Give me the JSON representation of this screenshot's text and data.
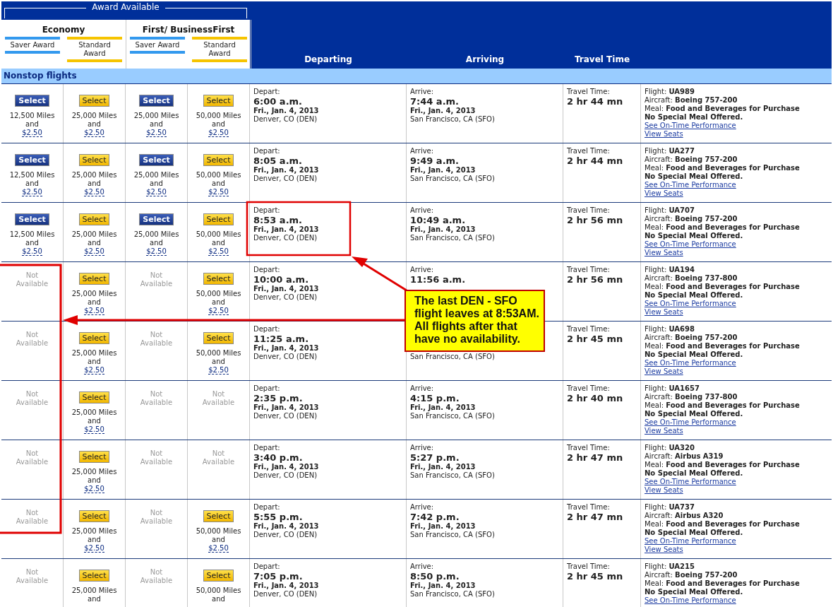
{
  "award_header": {
    "title": "Award Available",
    "groups": [
      {
        "name": "Economy",
        "awards": [
          {
            "label": "Saver Award",
            "kind": "saver"
          },
          {
            "label": "Standard Award",
            "kind": "standard"
          }
        ]
      },
      {
        "name": "First/ BusinessFirst",
        "awards": [
          {
            "label": "Saver Award",
            "kind": "saver"
          },
          {
            "label": "Standard Award",
            "kind": "standard"
          }
        ]
      }
    ]
  },
  "columns": [
    "Departing",
    "Arriving",
    "Travel Time"
  ],
  "section": "Nonstop flights",
  "flights": [
    {
      "options": [
        {
          "kind": "saver",
          "available": true,
          "button": "Select",
          "miles": "12,500 Miles",
          "and": "and",
          "fee": "$2.50"
        },
        {
          "kind": "standard",
          "available": true,
          "button": "Select",
          "miles": "25,000 Miles",
          "and": "and",
          "fee": "$2.50"
        },
        {
          "kind": "saver",
          "available": true,
          "button": "Select",
          "miles": "25,000 Miles",
          "and": "and",
          "fee": "$2.50"
        },
        {
          "kind": "standard",
          "available": true,
          "button": "Select",
          "miles": "50,000 Miles",
          "and": "and",
          "fee": "$2.50"
        }
      ],
      "depart": {
        "label": "Depart:",
        "time": "6:00 a.m.",
        "date": "Fri., Jan. 4, 2013",
        "city": "Denver, CO (DEN)"
      },
      "arrive": {
        "label": "Arrive:",
        "time": "7:44 a.m.",
        "date": "Fri., Jan. 4, 2013",
        "city": "San Francisco, CA (SFO)"
      },
      "travel": {
        "label": "Travel Time:",
        "value": "2 hr 44 mn"
      },
      "info": {
        "flight": "Flight: **UA989**",
        "aircraft": "Aircraft: **Boeing 757-200**",
        "meal": "Meal: **Food and Beverages for Purchase**",
        "note": "No Special Meal Offered.",
        "links": [
          "See On-Time Performance",
          "View Seats"
        ]
      }
    },
    {
      "options": [
        {
          "kind": "saver",
          "available": true,
          "button": "Select",
          "miles": "12,500 Miles",
          "and": "and",
          "fee": "$2.50"
        },
        {
          "kind": "standard",
          "available": true,
          "button": "Select",
          "miles": "25,000 Miles",
          "and": "and",
          "fee": "$2.50"
        },
        {
          "kind": "saver",
          "available": true,
          "button": "Select",
          "miles": "25,000 Miles",
          "and": "and",
          "fee": "$2.50"
        },
        {
          "kind": "standard",
          "available": true,
          "button": "Select",
          "miles": "50,000 Miles",
          "and": "and",
          "fee": "$2.50"
        }
      ],
      "depart": {
        "label": "Depart:",
        "time": "8:05 a.m.",
        "date": "Fri., Jan. 4, 2013",
        "city": "Denver, CO (DEN)"
      },
      "arrive": {
        "label": "Arrive:",
        "time": "9:49 a.m.",
        "date": "Fri., Jan. 4, 2013",
        "city": "San Francisco, CA (SFO)"
      },
      "travel": {
        "label": "Travel Time:",
        "value": "2 hr 44 mn"
      },
      "info": {
        "flight": "Flight: **UA277**",
        "aircraft": "Aircraft: **Boeing 757-200**",
        "meal": "Meal: **Food and Beverages for Purchase**",
        "note": "No Special Meal Offered.",
        "links": [
          "See On-Time Performance",
          "View Seats"
        ]
      }
    },
    {
      "options": [
        {
          "kind": "saver",
          "available": true,
          "button": "Select",
          "miles": "12,500 Miles",
          "and": "and",
          "fee": "$2.50"
        },
        {
          "kind": "standard",
          "available": true,
          "button": "Select",
          "miles": "25,000 Miles",
          "and": "and",
          "fee": "$2.50"
        },
        {
          "kind": "saver",
          "available": true,
          "button": "Select",
          "miles": "25,000 Miles",
          "and": "and",
          "fee": "$2.50"
        },
        {
          "kind": "standard",
          "available": true,
          "button": "Select",
          "miles": "50,000 Miles",
          "and": "and",
          "fee": "$2.50"
        }
      ],
      "depart": {
        "label": "Depart:",
        "time": "8:53 a.m.",
        "date": "Fri., Jan. 4, 2013",
        "city": "Denver, CO (DEN)"
      },
      "arrive": {
        "label": "Arrive:",
        "time": "10:49 a.m.",
        "date": "Fri., Jan. 4, 2013",
        "city": "San Francisco, CA (SFO)"
      },
      "travel": {
        "label": "Travel Time:",
        "value": "2 hr 56 mn"
      },
      "info": {
        "flight": "Flight: **UA707**",
        "aircraft": "Aircraft: **Boeing 757-200**",
        "meal": "Meal: **Food and Beverages for Purchase**",
        "note": "No Special Meal Offered.",
        "links": [
          "See On-Time Performance",
          "View Seats"
        ]
      }
    },
    {
      "options": [
        {
          "kind": "saver",
          "available": false,
          "text": "Not Available"
        },
        {
          "kind": "standard",
          "available": true,
          "button": "Select",
          "miles": "25,000 Miles",
          "and": "and",
          "fee": "$2.50"
        },
        {
          "kind": "saver",
          "available": false,
          "text": "Not Available"
        },
        {
          "kind": "standard",
          "available": true,
          "button": "Select",
          "miles": "50,000 Miles",
          "and": "and",
          "fee": "$2.50"
        }
      ],
      "depart": {
        "label": "Depart:",
        "time": "10:00 a.m.",
        "date": "Fri., Jan. 4, 2013",
        "city": "Denver, CO (DEN)"
      },
      "arrive": {
        "label": "Arrive:",
        "time": "11:56 a.m."
      },
      "travel": {
        "label": "Travel Time:",
        "value": "2 hr 56 mn"
      },
      "info": {
        "flight": "Flight: **UA194**",
        "aircraft": "Aircraft: **Boeing 737-800**",
        "meal": "Meal: **Food and Beverages for Purchase**",
        "note": "No Special Meal Offered.",
        "links": [
          "See On-Time Performance",
          "View Seats"
        ]
      }
    },
    {
      "options": [
        {
          "kind": "saver",
          "available": false,
          "text": "Not Available"
        },
        {
          "kind": "standard",
          "available": true,
          "button": "Select",
          "miles": "25,000 Miles",
          "and": "and",
          "fee": "$2.50"
        },
        {
          "kind": "saver",
          "available": false,
          "text": "Not Available"
        },
        {
          "kind": "standard",
          "available": true,
          "button": "Select",
          "miles": "50,000 Miles",
          "and": "and",
          "fee": "$2.50"
        }
      ],
      "depart": {
        "label": "Depart:",
        "time": "11:25 a.m.",
        "date": "Fri., Jan. 4, 2013",
        "city": "Denver, CO (DEN)"
      },
      "arrive": {
        "city": "San Francisco, CA (SFO)"
      },
      "travel": {
        "label": "Travel Time:",
        "value": "2 hr 45 mn"
      },
      "info": {
        "flight": "Flight: **UA698**",
        "aircraft": "Aircraft: **Boeing 757-200**",
        "meal": "Meal: **Food and Beverages for Purchase**",
        "note": "No Special Meal Offered.",
        "links": [
          "See On-Time Performance",
          "View Seats"
        ]
      }
    },
    {
      "options": [
        {
          "kind": "saver",
          "available": false,
          "text": "Not Available"
        },
        {
          "kind": "standard",
          "available": true,
          "button": "Select",
          "miles": "25,000 Miles",
          "and": "and",
          "fee": "$2.50"
        },
        {
          "kind": "saver",
          "available": false,
          "text": "Not Available"
        },
        {
          "kind": "standard",
          "available": false,
          "text": "Not Available"
        }
      ],
      "depart": {
        "label": "Depart:",
        "time": "2:35 p.m.",
        "date": "Fri., Jan. 4, 2013",
        "city": "Denver, CO (DEN)"
      },
      "arrive": {
        "label": "Arrive:",
        "time": "4:15 p.m.",
        "date": "Fri., Jan. 4, 2013",
        "city": "San Francisco, CA (SFO)"
      },
      "travel": {
        "label": "Travel Time:",
        "value": "2 hr 40 mn"
      },
      "info": {
        "flight": "Flight: **UA1657**",
        "aircraft": "Aircraft: **Boeing 737-800**",
        "meal": "Meal: **Food and Beverages for Purchase**",
        "note": "No Special Meal Offered.",
        "links": [
          "See On-Time Performance",
          "View Seats"
        ]
      }
    },
    {
      "options": [
        {
          "kind": "saver",
          "available": false,
          "text": "Not Available"
        },
        {
          "kind": "standard",
          "available": true,
          "button": "Select",
          "miles": "25,000 Miles",
          "and": "and",
          "fee": "$2.50"
        },
        {
          "kind": "saver",
          "available": false,
          "text": "Not Available"
        },
        {
          "kind": "standard",
          "available": false,
          "text": "Not Available"
        }
      ],
      "depart": {
        "label": "Depart:",
        "time": "3:40 p.m.",
        "date": "Fri., Jan. 4, 2013",
        "city": "Denver, CO (DEN)"
      },
      "arrive": {
        "label": "Arrive:",
        "time": "5:27 p.m.",
        "date": "Fri., Jan. 4, 2013",
        "city": "San Francisco, CA (SFO)"
      },
      "travel": {
        "label": "Travel Time:",
        "value": "2 hr 47 mn"
      },
      "info": {
        "flight": "Flight: **UA320**",
        "aircraft": "Aircraft: **Airbus A319**",
        "meal": "Meal: **Food and Beverages for Purchase**",
        "note": "No Special Meal Offered.",
        "links": [
          "See On-Time Performance",
          "View Seats"
        ]
      }
    },
    {
      "options": [
        {
          "kind": "saver",
          "available": false,
          "text": "Not Available"
        },
        {
          "kind": "standard",
          "available": true,
          "button": "Select",
          "miles": "25,000 Miles",
          "and": "and",
          "fee": "$2.50"
        },
        {
          "kind": "saver",
          "available": false,
          "text": "Not Available"
        },
        {
          "kind": "standard",
          "available": true,
          "button": "Select",
          "miles": "50,000 Miles",
          "and": "and",
          "fee": "$2.50"
        }
      ],
      "depart": {
        "label": "Depart:",
        "time": "5:55 p.m.",
        "date": "Fri., Jan. 4, 2013",
        "city": "Denver, CO (DEN)"
      },
      "arrive": {
        "label": "Arrive:",
        "time": "7:42 p.m.",
        "date": "Fri., Jan. 4, 2013",
        "city": "San Francisco, CA (SFO)"
      },
      "travel": {
        "label": "Travel Time:",
        "value": "2 hr 47 mn"
      },
      "info": {
        "flight": "Flight: **UA737**",
        "aircraft": "Aircraft: **Airbus A320**",
        "meal": "Meal: **Food and Beverages for Purchase**",
        "note": "No Special Meal Offered.",
        "links": [
          "See On-Time Performance",
          "View Seats"
        ]
      }
    },
    {
      "options": [
        {
          "kind": "saver",
          "available": false,
          "text": "Not Available"
        },
        {
          "kind": "standard",
          "available": true,
          "button": "Select",
          "miles": "25,000 Miles",
          "and": "and"
        },
        {
          "kind": "saver",
          "available": false,
          "text": "Not Available"
        },
        {
          "kind": "standard",
          "available": true,
          "button": "Select",
          "miles": "50,000 Miles",
          "and": "and"
        }
      ],
      "depart": {
        "label": "Depart:",
        "time": "7:05 p.m.",
        "date": "Fri., Jan. 4, 2013",
        "city": "Denver, CO (DEN)"
      },
      "arrive": {
        "label": "Arrive:",
        "time": "8:50 p.m.",
        "date": "Fri., Jan. 4, 2013",
        "city": "San Francisco, CA (SFO)"
      },
      "travel": {
        "label": "Travel Time:",
        "value": "2 hr 45 mn"
      },
      "info": {
        "flight": "Flight: **UA215**",
        "aircraft": "Aircraft: **Boeing 757-200**",
        "meal": "Meal: **Food and Beverages for Purchase**",
        "note": "No Special Meal Offered.",
        "links": [
          "See On-Time Performance"
        ]
      }
    }
  ],
  "annotation": {
    "callout": "The last DEN - SFO flight leaves at 8:53AM. All flights after that have no availability."
  }
}
